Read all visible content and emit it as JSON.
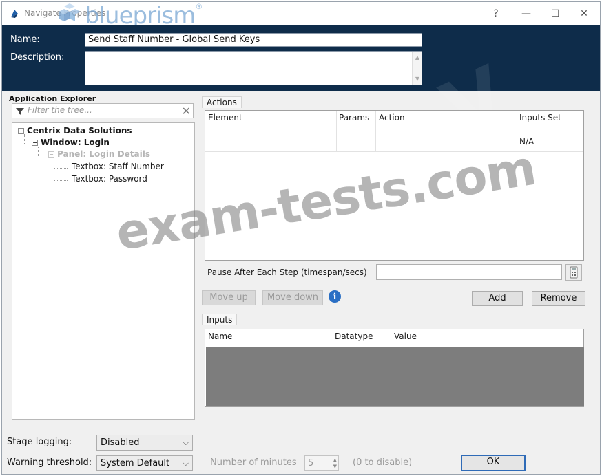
{
  "window": {
    "title": "Navigate Properties",
    "brand_text": "blueprism",
    "brand_mark": "®",
    "controls": {
      "help": "?",
      "minimize": "—",
      "maximize": "☐",
      "close": "✕"
    }
  },
  "header": {
    "name_label": "Name:",
    "name_value": "Send Staff Number - Global Send Keys",
    "description_label": "Description:",
    "description_value": ""
  },
  "app_explorer": {
    "label": "Application Explorer",
    "filter_placeholder": "Filter the tree...",
    "tree": [
      {
        "label": "Centrix Data Solutions"
      },
      {
        "label": "Window: Login"
      },
      {
        "label": "Panel: Login Details"
      },
      {
        "label": "Textbox: Staff Number"
      },
      {
        "label": "Textbox: Password"
      }
    ]
  },
  "actions": {
    "label": "Actions",
    "columns": [
      "Element",
      "Params",
      "Action",
      "Inputs Set"
    ],
    "rows": [
      {
        "element": "",
        "params": "",
        "action": "",
        "inputs_set": "N/A"
      }
    ],
    "pause_label": "Pause After Each Step (timespan/secs)",
    "pause_value": "",
    "move_up": "Move up",
    "move_down": "Move down",
    "add": "Add",
    "remove": "Remove"
  },
  "inputs": {
    "label": "Inputs",
    "columns": [
      "Name",
      "Datatype",
      "Value"
    ]
  },
  "footer": {
    "stage_logging_label": "Stage logging:",
    "stage_logging_value": "Disabled",
    "warning_label": "Warning threshold:",
    "warning_value": "System Default",
    "minutes_label": "Number of minutes",
    "minutes_value": "5",
    "zero_hint": "(0 to disable)",
    "ok": "OK"
  },
  "watermark": "exam-tests.com",
  "colors": {
    "header_bg": "#0e2c4a",
    "window_bg": "#f0f0f0",
    "ok_border": "#2f6bb7",
    "info_blue": "#2a6fc4",
    "grey_area": "#7d7d7d"
  }
}
